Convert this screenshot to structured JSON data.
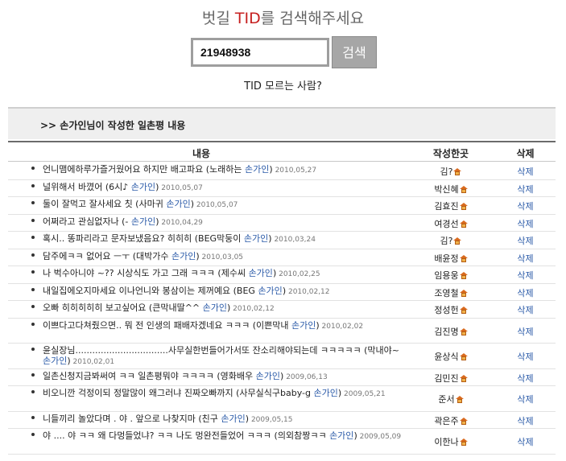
{
  "header": {
    "title_prefix": "벗길 ",
    "title_highlight": "TID",
    "title_suffix": "를 검색해주세요"
  },
  "search": {
    "value": "21948938",
    "button_label": "검색"
  },
  "unknown_link": "TID 모르는 사람?",
  "section": {
    "title": ">> 손가인님이 작성한 일촌평 내용"
  },
  "table": {
    "headers": {
      "content": "내용",
      "author": "작성한곳",
      "delete": "삭제"
    },
    "rows": [
      {
        "text": "언니맴에하루가즐거웠어요 하지만 배고파요 (노래하는 ",
        "nick": "손가인",
        "close": ")",
        "date": " 2010,05,27",
        "author": "김?",
        "delete": "삭제"
      },
      {
        "text": "널위해서 바꼈어 (6시♪ ",
        "nick": "손가인",
        "close": ")",
        "date": " 2010,05,07",
        "author": "박신혜",
        "delete": "삭제"
      },
      {
        "text": "둘이 잘먹고 잘사세요 칫 (사마귀 ",
        "nick": "손가인",
        "close": ")",
        "date": " 2010,05,07",
        "author": "김효진",
        "delete": "삭제"
      },
      {
        "text": "어쩌라고 관심없자나 (- ",
        "nick": "손가인",
        "close": ")",
        "date": " 2010,04,29",
        "author": "여경선",
        "delete": "삭제"
      },
      {
        "text": "혹시.. 똥파리라고 문자보냈음요? 히히히 (BEG막둥이 ",
        "nick": "손가인",
        "close": ")",
        "date": " 2010,03,24",
        "author": "김?",
        "delete": "삭제"
      },
      {
        "text": "담주에ㅋㅋ 없어요 ㅡㅜ (대박가수 ",
        "nick": "손가인",
        "close": ")",
        "date": " 2010,03,05",
        "author": "배윤정",
        "delete": "삭제"
      },
      {
        "text": "나 벅수아니야 ~?? 시상식도 가고 그래 ㅋㅋㅋ (제수씨 ",
        "nick": "손가인",
        "close": ")",
        "date": " 2010,02,25",
        "author": "임용웅",
        "delete": "삭제"
      },
      {
        "text": "내일집에오지마세요 이나언니와 봉삼이는 제꺼예요 (BEG ",
        "nick": "손가인",
        "close": ")",
        "date": " 2010,02,12",
        "author": "조영철",
        "delete": "삭제"
      },
      {
        "text": "오빠 히히히히히 보고싶어요 (큰막내딸^^ ",
        "nick": "손가인",
        "close": ")",
        "date": " 2010,02,12",
        "author": "정성헌",
        "delete": "삭제"
      },
      {
        "text": "이쁘다고다쳐줬으면.. 뭐 전 인생의 패배자겠네요 ㅋㅋㅋ (이쁜막내 ",
        "nick": "손가인",
        "close": ")",
        "date": " 2010,02,02",
        "author": "김진명",
        "delete": "삭제"
      },
      {
        "text": "윤실장님.................................사무실한번들어가서또 잔소리해야되는데 ㅋㅋㅋㅋㅋ (막내야~ ",
        "nick": "손가인",
        "close": ")",
        "date": " 2010,02,01",
        "author": "윤상식",
        "delete": "삭제"
      },
      {
        "text": "일촌신청지금봐써여 ㅋㅋ 일촌평뭐야 ㅋㅋㅋㅋ (영화배우 ",
        "nick": "손가인",
        "close": ")",
        "date": " 2009,06,13",
        "author": "김민진",
        "delete": "삭제"
      },
      {
        "text": "비오니깐 걱정이되 정말많이 왜그러냐 진짜오빠까지 (사무실식구baby-g ",
        "nick": "손가인",
        "close": ")",
        "date": " 2009,05,21",
        "author": "준서",
        "delete": "삭제"
      },
      {
        "text": "니들끼리 놀았다며 . 야 . 앞으로 나찾지마 (친구 ",
        "nick": "손가인",
        "close": ")",
        "date": " 2009,05,15",
        "author": "곽은주",
        "delete": "삭제"
      },
      {
        "text": "야 .... 야 ㅋㅋ 왜 다멍들었냐? ㅋㅋ 나도 멍완전들었어 ㅋㅋㅋ (의외참짱ㅋㅋ ",
        "nick": "손가인",
        "close": ")",
        "date": " 2009,05,09",
        "author": "이한나",
        "delete": "삭제"
      }
    ]
  },
  "colors": {
    "highlight": "#c62020",
    "link": "#2a5aa8",
    "button": "#a6a6a6"
  },
  "icons": {
    "author_icon": "home-icon"
  }
}
